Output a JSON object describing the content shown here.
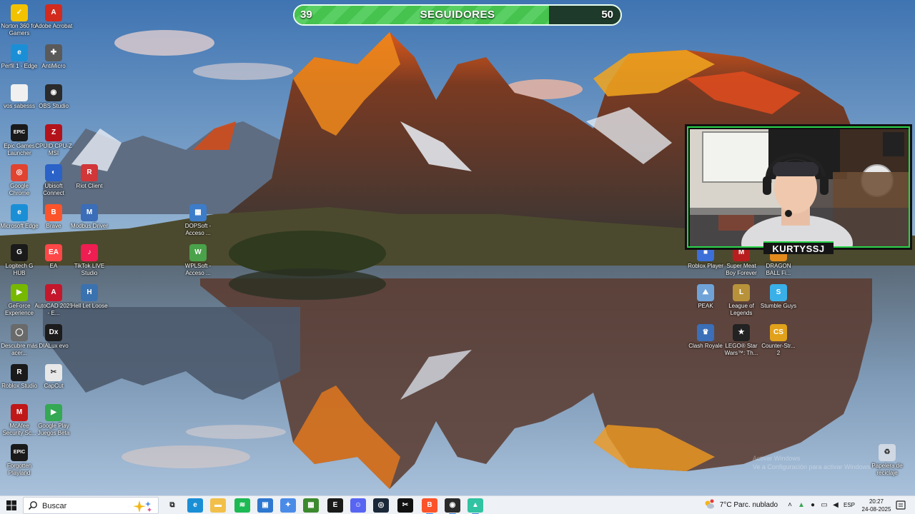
{
  "overlay": {
    "follower_current": "39",
    "follower_goal": "50",
    "follower_title": "SEGUIDORES",
    "progress": 0.78,
    "streamer_name": "KURTYSSJ"
  },
  "desktop_icons": [
    {
      "label": "Norton 360 for Gamers",
      "icon": "norton-icon",
      "color": "#f2c200"
    },
    {
      "label": "Adobe Acrobat",
      "icon": "acrobat-icon",
      "color": "#d32a1e"
    },
    {
      "label": "Perfil 1 - Edge",
      "icon": "edge-icon",
      "color": "#1b8fd6"
    },
    {
      "label": "AntiMicro",
      "icon": "gamepad-icon",
      "color": "#5a5a5a"
    },
    {
      "label": "vos sabesss",
      "icon": "file-icon",
      "color": "#f0f0f0"
    },
    {
      "label": "OBS Studio",
      "icon": "obs-icon",
      "color": "#2b2b2b"
    },
    {
      "label": "Epic Games Launcher",
      "icon": "epic-icon",
      "color": "#1a1a1a"
    },
    {
      "label": "CPUID CPU-Z MSI",
      "icon": "cpuz-icon",
      "color": "#b3121a"
    },
    {
      "label": "Google Chrome",
      "icon": "chrome-icon",
      "color": "#e0432f"
    },
    {
      "label": "Ubisoft Connect",
      "icon": "ubisoft-icon",
      "color": "#2a62c8"
    },
    {
      "label": "Riot Client",
      "icon": "riot-icon",
      "color": "#d13639"
    },
    {
      "label": "Microsoft Edge",
      "icon": "edge-icon",
      "color": "#1b8fd6"
    },
    {
      "label": "Brave",
      "icon": "brave-icon",
      "color": "#fb542b"
    },
    {
      "label": "Modbus Driver",
      "icon": "modbus-icon",
      "color": "#3b6db8"
    },
    {
      "label": "Logitech G HUB",
      "icon": "logitech-icon",
      "color": "#1a1a1a"
    },
    {
      "label": "EA",
      "icon": "ea-icon",
      "color": "#ff4747"
    },
    {
      "label": "TikTok LIVE Studio",
      "icon": "tiktok-icon",
      "color": "#ee1d52"
    },
    {
      "label": "GeForce Experience",
      "icon": "geforce-icon",
      "color": "#76b900"
    },
    {
      "label": "AutoCAD 2025 - E...",
      "icon": "autocad-icon",
      "color": "#c4172c"
    },
    {
      "label": "Hell Let Loose",
      "icon": "hellletloose-icon",
      "color": "#3a72b0"
    },
    {
      "label": "Descubre más acer...",
      "icon": "globe-icon",
      "color": "#6a6a6a"
    },
    {
      "label": "DIALux evo",
      "icon": "dialux-icon",
      "color": "#1c1c1c"
    },
    {
      "label": "Roblox Studio",
      "icon": "roblox-studio-icon",
      "color": "#1a1a1a"
    },
    {
      "label": "CapCut",
      "icon": "capcut-icon",
      "color": "#e8e8e8"
    },
    {
      "label": "McAfee Security Sc...",
      "icon": "mcafee-icon",
      "color": "#c01818"
    },
    {
      "label": "Google Play Juegos Beta",
      "icon": "googleplay-icon",
      "color": "#34a853"
    },
    {
      "label": "Forgotten Playland",
      "icon": "epic-icon",
      "color": "#1a1a1a"
    },
    {
      "label": "DOPSoft - Acceso ...",
      "icon": "dopsoft-icon",
      "color": "#3d7cc9"
    },
    {
      "label": "WPLSoft - Acceso ...",
      "icon": "wplsoft-icon",
      "color": "#4aa24a"
    },
    {
      "label": "Roblox Player",
      "icon": "roblox-icon",
      "color": "#3d6fd9"
    },
    {
      "label": "Super Meat Boy Forever",
      "icon": "meatboy-icon",
      "color": "#b81e1e"
    },
    {
      "label": "DRAGON BALL Fi...",
      "icon": "dragonball-icon",
      "color": "#e28a1c"
    },
    {
      "label": "PEAK",
      "icon": "peak-icon",
      "color": "#6fa3d8"
    },
    {
      "label": "League of Legends",
      "icon": "lol-icon",
      "color": "#b8923a"
    },
    {
      "label": "Stumble Guys",
      "icon": "stumble-icon",
      "color": "#3ab0e8"
    },
    {
      "label": "Clash Royale",
      "icon": "clashroyale-icon",
      "color": "#3b6fb8"
    },
    {
      "label": "LEGO® Star Wars™: Th...",
      "icon": "lego-starwars-icon",
      "color": "#222"
    },
    {
      "label": "Counter-Str... 2",
      "icon": "cs2-icon",
      "color": "#e1a11b"
    },
    {
      "label": "Papelera de reciclaje",
      "icon": "recycle-bin-icon",
      "color": "#cfd8e3"
    }
  ],
  "watermark": {
    "line1": "Activar Windows",
    "line2": "Ve a Configuración para activar Windows."
  },
  "taskbar": {
    "search_placeholder": "Buscar",
    "apps": [
      {
        "name": "task-view",
        "icon": "task-view-icon",
        "color": "#333"
      },
      {
        "name": "edge",
        "icon": "edge-icon",
        "color": "#1b8fd6"
      },
      {
        "name": "file-explorer",
        "icon": "folder-icon",
        "color": "#f2c04a"
      },
      {
        "name": "spotify",
        "icon": "spotify-icon",
        "color": "#1db954"
      },
      {
        "name": "store",
        "icon": "store-icon",
        "color": "#2f78d0"
      },
      {
        "name": "copilot",
        "icon": "copilot-icon",
        "color": "#4a8be8"
      },
      {
        "name": "minecraft",
        "icon": "minecraft-icon",
        "color": "#3c8a2e"
      },
      {
        "name": "epic-games",
        "icon": "epic-icon",
        "color": "#1a1a1a"
      },
      {
        "name": "discord",
        "icon": "discord-icon",
        "color": "#5865f2"
      },
      {
        "name": "steam",
        "icon": "steam-icon",
        "color": "#1b2838"
      },
      {
        "name": "capcut",
        "icon": "capcut-icon",
        "color": "#111"
      },
      {
        "name": "brave",
        "icon": "brave-icon",
        "color": "#fb542b"
      },
      {
        "name": "obs",
        "icon": "obs-icon",
        "color": "#2b2b2b"
      },
      {
        "name": "streamlabs",
        "icon": "streamlabs-icon",
        "color": "#31c3a2"
      }
    ],
    "weather_temp": "7°C",
    "weather_desc": "Parc. nublado",
    "language": "ESP",
    "time": "20:27",
    "date": "24-08-2025"
  }
}
